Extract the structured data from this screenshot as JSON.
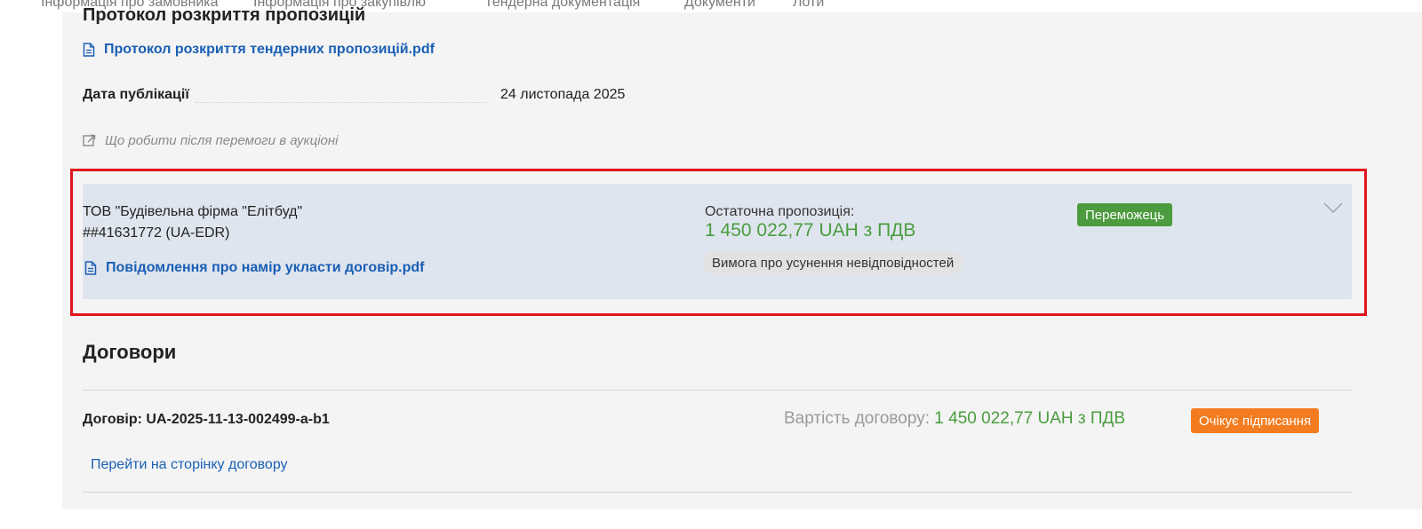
{
  "topnav": {
    "tabs": [
      {
        "label": "Інформація про замовника"
      },
      {
        "label": "Інформація про закупівлю"
      },
      {
        "label": "Тендерна документація"
      },
      {
        "label": "Документи"
      },
      {
        "label": "Лоти"
      }
    ]
  },
  "protocol": {
    "section_title": "Протокол розкриття пропозицій",
    "file_link": "Протокол розкриття тендерних пропозицій.pdf",
    "pub_date_label": "Дата публікації",
    "pub_date_value": "24 листопада 2025",
    "help_link": "Що робити після перемоги в аукціоні"
  },
  "bid": {
    "bidder_name": "ТОВ \"Будівельна фірма \"Елітбуд\"",
    "bidder_id": "##41631772 (UA-EDR)",
    "notice_file": "Повідомлення про намір укласти договір.pdf",
    "offer_label": "Остаточна пропозиція:",
    "offer_value": "1 450 022,77 UAH з ПДВ",
    "requirement_chip": "Вимога про усунення невідповідностей",
    "status_badge": "Переможець",
    "status_color": "#4c9b3e"
  },
  "contracts": {
    "title": "Договори",
    "contract_label": "Договір: UA-2025-11-13-002499-a-b1",
    "cost_label": "Вартість договору: ",
    "cost_value": "1 450 022,77 UAH з ПДВ",
    "status_badge": "Очікує підписання",
    "status_color": "#f47c20",
    "contract_link": "Перейти на сторінку договору"
  },
  "colors": {
    "link": "#1a5fb4",
    "money": "#4a9d3f",
    "highlight_border": "#e0161b",
    "card_bg": "#dfe5ee"
  },
  "icons": [
    "document-icon",
    "external-link-icon",
    "chevron-down-icon"
  ]
}
